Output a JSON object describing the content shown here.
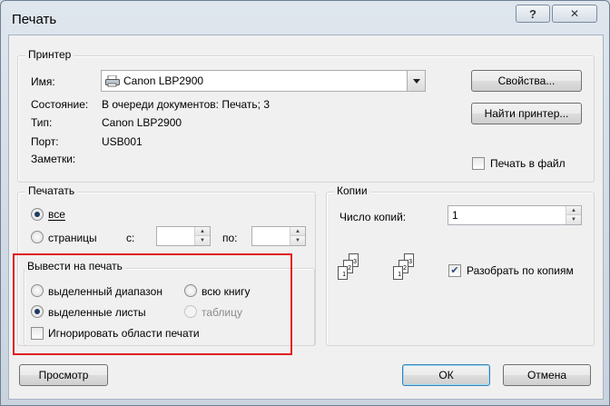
{
  "window": {
    "title": "Печать",
    "help_glyph": "?",
    "close_glyph": "✕"
  },
  "printer": {
    "group_label": "Принтер",
    "name_label": "Имя:",
    "name_value": "Canon LBP2900",
    "status_label": "Состояние:",
    "status_value": "В очереди документов: Печать; 3",
    "type_label": "Тип:",
    "type_value": "Canon LBP2900",
    "port_label": "Порт:",
    "port_value": "USB001",
    "notes_label": "Заметки:",
    "properties_button": "Свойства...",
    "find_printer_button": "Найти принтер...",
    "print_to_file_label": "Печать в файл",
    "print_to_file_checked": false
  },
  "range": {
    "group_label": "Печатать",
    "all_label": "все",
    "pages_label": "страницы",
    "from_label": "с:",
    "to_label": "по:",
    "from_value": "",
    "to_value": "",
    "selected": "all"
  },
  "copies": {
    "group_label": "Копии",
    "count_label": "Число копий:",
    "count_value": "1",
    "collate_label": "Разобрать по копиям",
    "collate_checked": true,
    "icon_labels": [
      "1",
      "2",
      "3"
    ]
  },
  "print_what": {
    "group_label": "Вывести на печать",
    "selection_label": "выделенный диапазон",
    "workbook_label": "всю книгу",
    "sheets_label": "выделенные листы",
    "table_label": "таблицу",
    "selected": "sheets",
    "ignore_areas_label": "Игнорировать области печати",
    "ignore_areas_checked": false
  },
  "buttons": {
    "preview": "Просмотр",
    "ok": "ОК",
    "cancel": "Отмена"
  },
  "highlight_color": "#e02020"
}
